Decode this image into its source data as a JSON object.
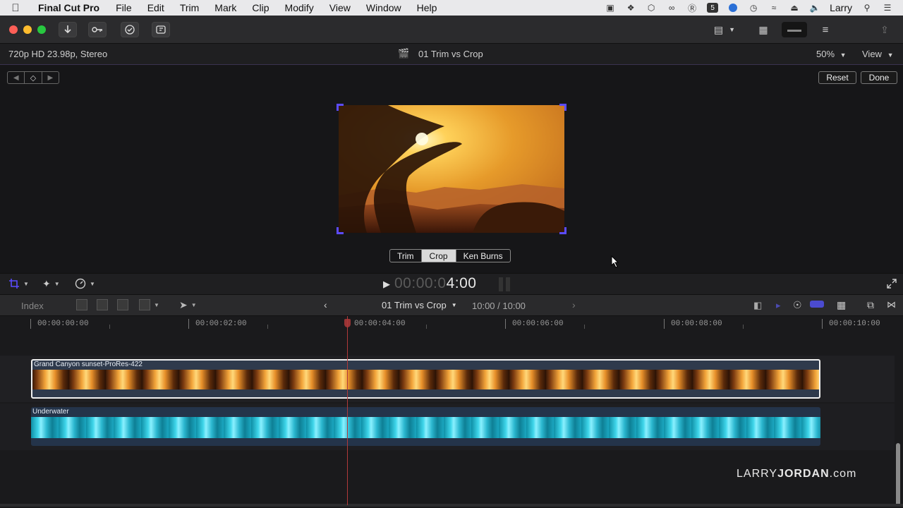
{
  "menubar": {
    "app_name": "Final Cut Pro",
    "menus": [
      "File",
      "Edit",
      "Trim",
      "Mark",
      "Clip",
      "Modify",
      "View",
      "Window",
      "Help"
    ],
    "user": "Larry"
  },
  "viewer_header": {
    "format": "720p HD 23.98p, Stereo",
    "project_title": "01 Trim vs Crop",
    "zoom": "50%",
    "view_label": "View"
  },
  "viewer": {
    "reset_label": "Reset",
    "done_label": "Done",
    "modes": [
      "Trim",
      "Crop",
      "Ken Burns"
    ],
    "active_mode": "Crop"
  },
  "playback": {
    "timecode_dim": "00:00:0",
    "timecode_bright": "4:00"
  },
  "timeline_toolbar": {
    "index_label": "Index",
    "project_name": "01 Trim vs Crop",
    "duration": "10:00 / 10:00"
  },
  "ruler": {
    "ticks": [
      "00:00:00:00",
      "00:00:02:00",
      "00:00:04:00",
      "00:00:06:00",
      "00:00:08:00",
      "00:00:10:00"
    ]
  },
  "clips": {
    "sunset_name": "Grand Canyon sunset-ProRes-422",
    "water_name": "Underwater"
  },
  "watermark": {
    "part1": "LARRY",
    "part2": "JORDAN",
    "part3": ".com"
  },
  "colors": {
    "accent_purple": "#5b4bff",
    "playhead": "#b03a3a",
    "clip_border": "#f0f0f0"
  }
}
